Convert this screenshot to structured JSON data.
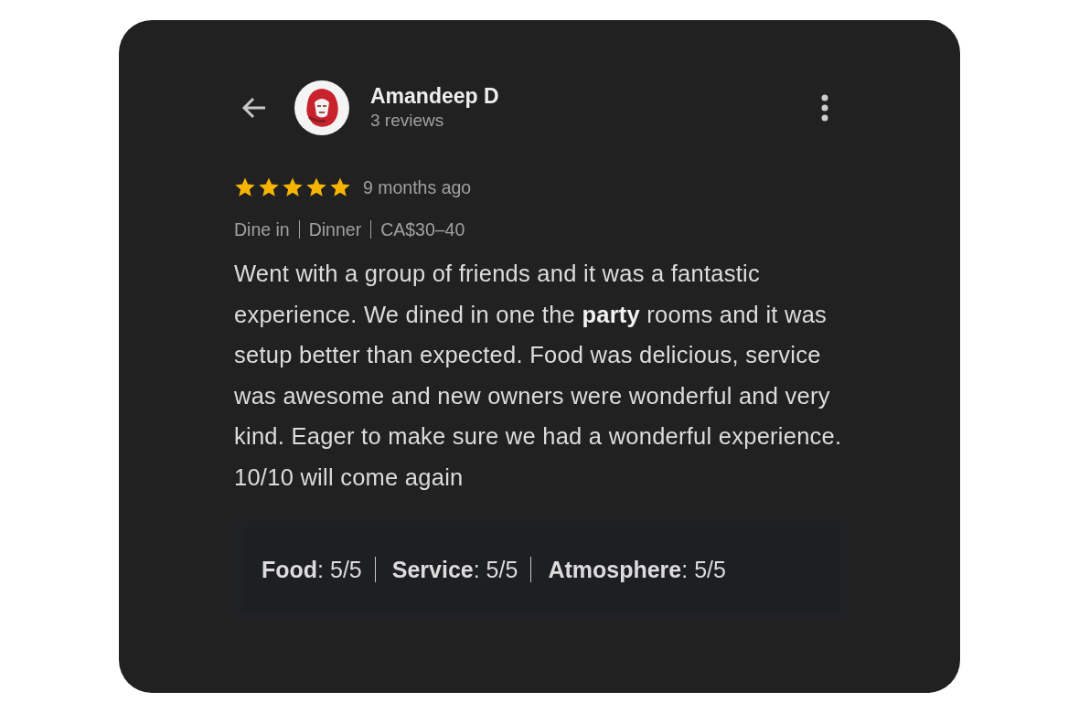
{
  "reviewer": {
    "name": "Amandeep D",
    "review_count": "3 reviews"
  },
  "review": {
    "stars": 5,
    "time": "9 months ago",
    "tags": [
      "Dine in",
      "Dinner",
      "CA$30–40"
    ],
    "text": "Went with a group of friends and it was a fantastic experience. We dined in one the **party** rooms and it was setup better than expected. Food was delicious, service was awesome and new owners were wonderful and very kind. Eager to make sure we had a wonderful experience. 10/10 will come again",
    "ratings": [
      "**Food**: 5/5",
      "**Service**: 5/5",
      "**Atmosphere**: 5/5"
    ]
  }
}
